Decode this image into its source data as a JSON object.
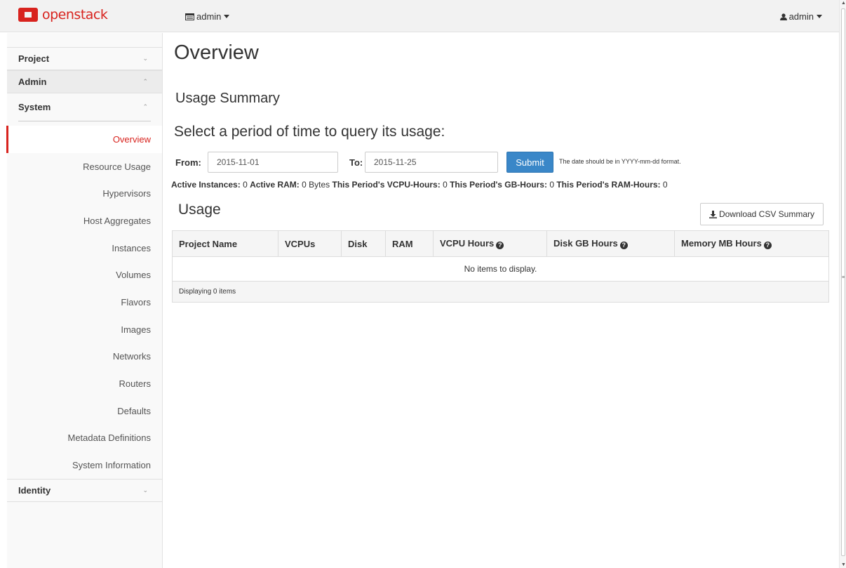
{
  "topbar": {
    "brand": "openstack",
    "project_switch_label": "admin",
    "user_menu_label": "admin"
  },
  "sidebar": {
    "sections": {
      "project": "Project",
      "admin": "Admin",
      "system": "System",
      "identity": "Identity"
    },
    "system_items": [
      "Overview",
      "Resource Usage",
      "Hypervisors",
      "Host Aggregates",
      "Instances",
      "Volumes",
      "Flavors",
      "Images",
      "Networks",
      "Routers",
      "Defaults",
      "Metadata Definitions",
      "System Information"
    ]
  },
  "main": {
    "page_title": "Overview",
    "usage_summary_title": "Usage Summary",
    "period_title": "Select a period of time to query its usage:",
    "from_label": "From:",
    "from_value": "2015-11-01",
    "to_label": "To:",
    "to_value": "2015-11-25",
    "submit_label": "Submit",
    "date_hint": "The date should be in YYYY-mm-dd format.",
    "stats": {
      "active_instances_label": "Active Instances:",
      "active_instances_value": "0",
      "active_ram_label": "Active RAM:",
      "active_ram_value": "0 Bytes",
      "vcpu_hours_label": "This Period's VCPU-Hours:",
      "vcpu_hours_value": "0",
      "gb_hours_label": "This Period's GB-Hours:",
      "gb_hours_value": "0",
      "ram_hours_label": "This Period's RAM-Hours:",
      "ram_hours_value": "0"
    },
    "usage_title": "Usage",
    "download_label": "Download CSV Summary",
    "table": {
      "columns": [
        "Project Name",
        "VCPUs",
        "Disk",
        "RAM",
        "VCPU Hours",
        "Disk GB Hours",
        "Memory MB Hours"
      ],
      "empty_message": "No items to display.",
      "footer": "Displaying 0 items"
    }
  },
  "colors": {
    "brand_red": "#d8231e",
    "submit_blue": "#3a87c8"
  },
  "icons": {
    "project_switch": "list-icon",
    "user": "user-icon",
    "download": "download-icon",
    "help": "question-circle-icon"
  }
}
